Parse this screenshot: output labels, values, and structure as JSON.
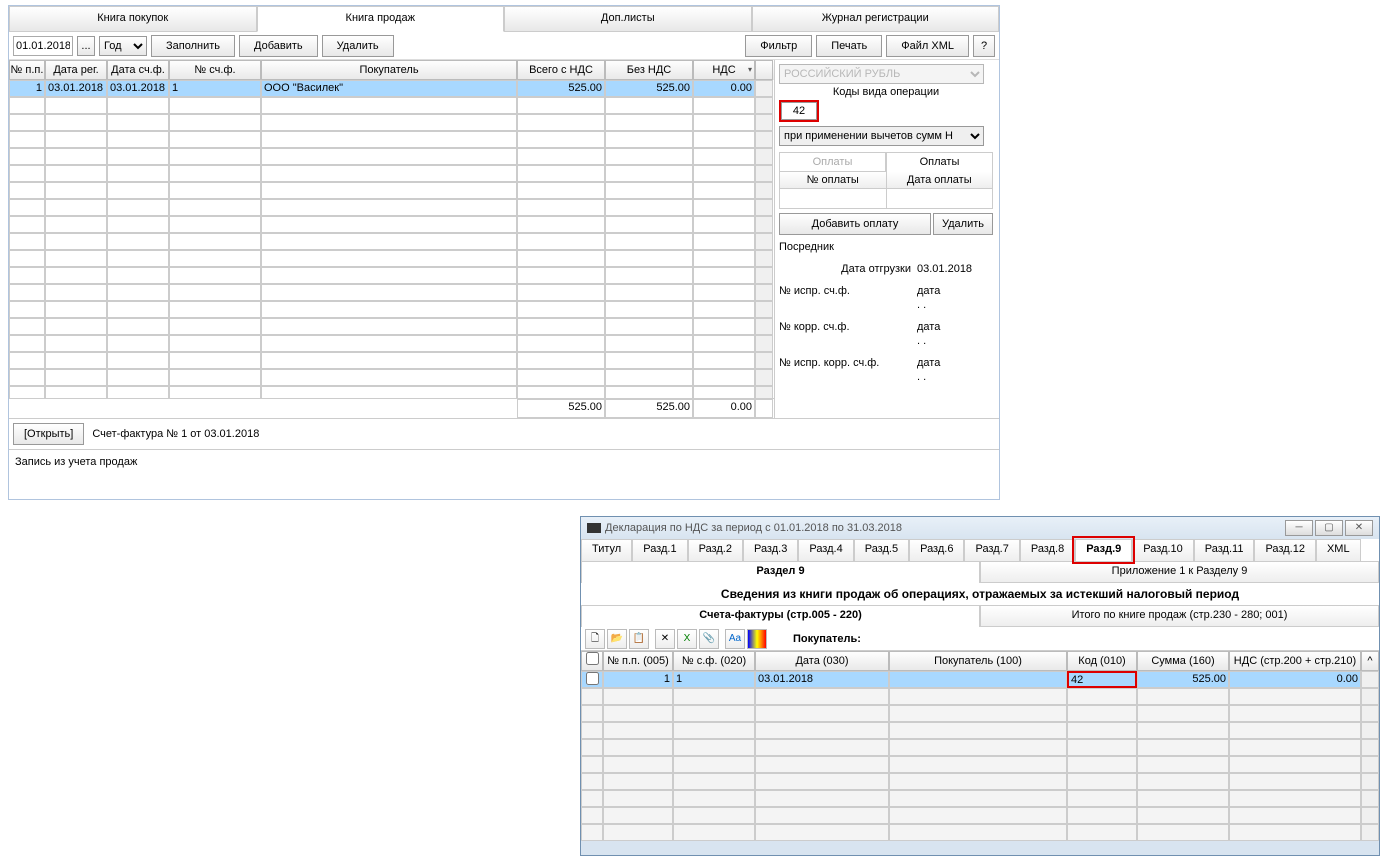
{
  "window1": {
    "tabs": [
      "Книга покупок",
      "Книга продаж",
      "Доп.листы",
      "Журнал регистрации"
    ],
    "active_tab": 1,
    "date_from": "01.01.2018",
    "period_select": "Год",
    "buttons": {
      "fill": "Заполнить",
      "add": "Добавить",
      "delete": "Удалить",
      "filter": "Фильтр",
      "print": "Печать",
      "xml": "Файл XML",
      "help": "?"
    },
    "grid_headers": {
      "num": "№ п.п.",
      "date_reg": "Дата рег.",
      "date_sf": "Дата сч.ф.",
      "num_sf": "№ сч.ф.",
      "buyer": "Покупатель",
      "total": "Всего с НДС",
      "no_vat": "Без НДС",
      "vat": "НДС"
    },
    "grid_rows": [
      {
        "num": "1",
        "date_reg": "03.01.2018",
        "date_sf": "03.01.2018",
        "num_sf": "1",
        "buyer": "ООО \"Василек\"",
        "total": "525.00",
        "no_vat": "525.00",
        "vat": "0.00"
      }
    ],
    "totals": {
      "total": "525.00",
      "no_vat": "525.00",
      "vat": "0.00"
    },
    "open_btn": "[Открыть]",
    "open_label": "Счет-фактура № 1 от 03.01.2018",
    "status": "Запись из учета продаж",
    "side": {
      "currency": "РОССИЙСКИЙ РУБЛЬ",
      "opcode_label": "Коды вида операции",
      "opcode": "42",
      "opcode_desc": "при применении вычетов сумм Н",
      "pay_tabs": [
        "Оплаты",
        "Оплаты"
      ],
      "pay_headers": {
        "num": "№ оплаты",
        "date": "Дата оплаты"
      },
      "add_payment": "Добавить оплату",
      "del_payment": "Удалить",
      "mediator": "Посредник",
      "ship_label": "Дата отгрузки",
      "ship_date": "03.01.2018",
      "corr1_label": "№ испр. сч.ф.",
      "corr_date": "дата",
      "corr2_label": "№ корр. сч.ф.",
      "corr3_label": "№ испр. корр. сч.ф.",
      "dots": ". ."
    }
  },
  "window2": {
    "title": "Декларация по НДС за период с 01.01.2018 по 31.03.2018",
    "tabs": [
      "Титул",
      "Разд.1",
      "Разд.2",
      "Разд.3",
      "Разд.4",
      "Разд.5",
      "Разд.6",
      "Разд.7",
      "Разд.8",
      "Разд.9",
      "Разд.10",
      "Разд.11",
      "Разд.12",
      "XML"
    ],
    "active_tab": 9,
    "subtabs": [
      "Раздел 9",
      "Приложение 1 к Разделу 9"
    ],
    "section_title": "Сведения из книги продаж об операциях, отражаемых за истекший налоговый период",
    "subsubtabs": [
      "Счета-фактуры (стр.005 - 220)",
      "Итого по книге продаж (стр.230 - 280; 001)"
    ],
    "buyer_label": "Покупатель:",
    "grid_headers": {
      "num": "№ п.п. (005)",
      "sf": "№ с.ф. (020)",
      "date": "Дата (030)",
      "buyer": "Покупатель (100)",
      "code": "Код (010)",
      "sum": "Сумма (160)",
      "nds": "НДС (стр.200 + стр.210)"
    },
    "grid_rows": [
      {
        "num": "1",
        "sf": "1",
        "date": "03.01.2018",
        "buyer": "",
        "code": "42",
        "sum": "525.00",
        "nds": "0.00"
      }
    ]
  }
}
